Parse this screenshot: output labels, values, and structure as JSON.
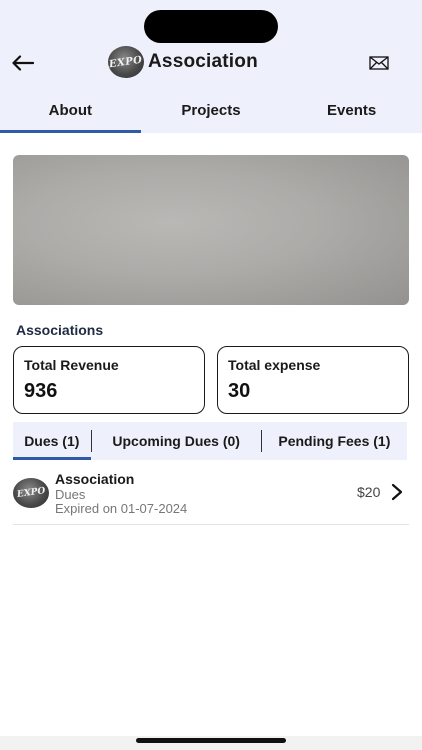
{
  "header": {
    "title": "Association",
    "logo_text": "EXPO",
    "back_icon": "arrow-left-icon",
    "mail_icon": "envelope-icon"
  },
  "tabs": [
    {
      "label": "About",
      "active": true
    },
    {
      "label": "Projects",
      "active": false
    },
    {
      "label": "Events",
      "active": false
    }
  ],
  "section": {
    "label": "Associations"
  },
  "stats": {
    "revenue": {
      "label": "Total Revenue",
      "value": "936"
    },
    "expense": {
      "label": "Total expense",
      "value": "30"
    }
  },
  "subtabs": [
    {
      "label": "Dues (1)",
      "active": true
    },
    {
      "label": "Upcoming Dues (0)",
      "active": false
    },
    {
      "label": "Pending Fees (1)",
      "active": false
    }
  ],
  "dues": [
    {
      "logo_text": "EXPO",
      "title": "Association",
      "type": "Dues",
      "expiry": "Expired on 01-07-2024",
      "amount": "$20",
      "chevron_icon": "chevron-right-icon"
    }
  ],
  "colors": {
    "accent": "#2f5aa8",
    "header_bg": "#eef0fb"
  }
}
